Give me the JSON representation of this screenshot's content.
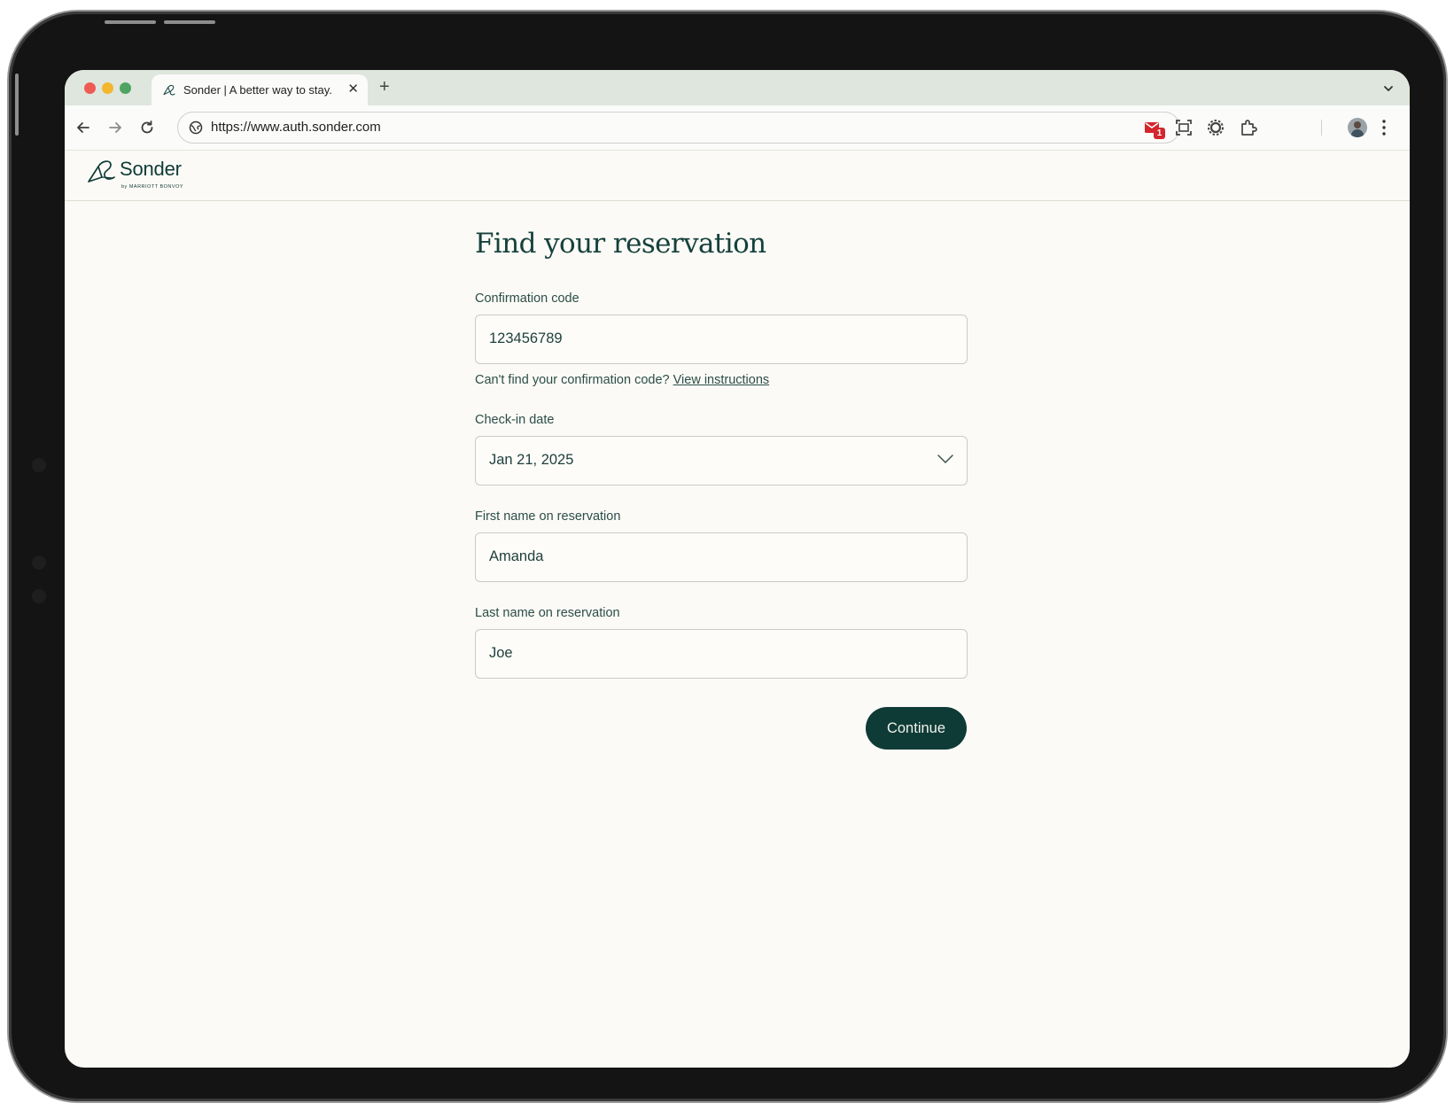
{
  "browser": {
    "tab_title": "Sonder | A better way to stay.",
    "tab_close": "✕",
    "new_tab": "+",
    "url": "https://www.auth.sonder.com",
    "extension_badge": "1",
    "icons": [
      "back-icon",
      "forward-icon",
      "reload-icon",
      "site-info-icon",
      "gmail-extension-icon",
      "screenshot-icon",
      "settings-extension-icon",
      "extensions-icon",
      "profile-avatar",
      "more-menu-icon"
    ]
  },
  "header": {
    "brand": "Sonder",
    "brand_sub": "by MARRIOTT BONVOY"
  },
  "form": {
    "title": "Find your reservation",
    "confirmation_label": "Confirmation code",
    "confirmation_value": "123456789",
    "help_text": "Can't find your confirmation code?",
    "help_link": "View instructions",
    "checkin_label": "Check-in date",
    "checkin_value": "Jan 21, 2025",
    "first_name_label": "First name on reservation",
    "first_name_value": "Amanda",
    "last_name_label": "Last name on reservation",
    "last_name_value": "Joe",
    "continue_label": "Continue"
  },
  "colors": {
    "brand_primary": "#0e3b36",
    "page_background": "#fcfaf6",
    "tab_strip": "#dfe6dd"
  }
}
